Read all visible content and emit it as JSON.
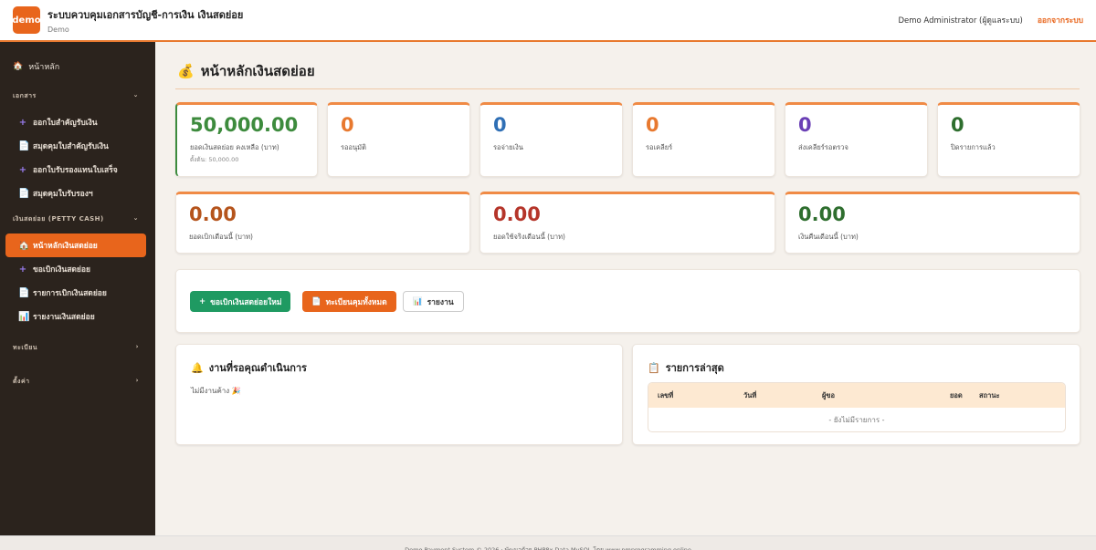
{
  "header": {
    "logo": "demo",
    "title": "ระบบควบคุมเอกสารบัญชี-การเงิน เงินสดย่อย",
    "subtitle": "Demo",
    "user": "Demo Administrator (ผู้ดูแลระบบ)",
    "logout": "ออกจากระบบ"
  },
  "sidebar": {
    "home": "หน้าหลัก",
    "sections": [
      {
        "label": "เอกสาร",
        "caret": "⌄"
      },
      {
        "label": "เงินสดย่อย (PETTY CASH)",
        "caret": "⌄"
      },
      {
        "label": "ทะเบียน",
        "caret": "›"
      },
      {
        "label": "ตั้งค่า",
        "caret": "›"
      }
    ],
    "doc_items": [
      {
        "label": "ออกใบสำคัญรับเงิน",
        "icon": "plus-icon"
      },
      {
        "label": "สมุดคุมใบสำคัญรับเงิน",
        "icon": "document-icon"
      },
      {
        "label": "ออกใบรับรองแทนใบเสร็จ",
        "icon": "plus-icon"
      },
      {
        "label": "สมุดคุมใบรับรองฯ",
        "icon": "document-icon"
      }
    ],
    "petty_items": [
      {
        "label": "หน้าหลักเงินสดย่อย",
        "icon": "home-icon"
      },
      {
        "label": "ขอเบิกเงินสดย่อย",
        "icon": "plus-icon"
      },
      {
        "label": "รายการเบิกเงินสดย่อย",
        "icon": "document-icon"
      },
      {
        "label": "รายงานเงินสดย่อย",
        "icon": "chart-icon"
      }
    ]
  },
  "main": {
    "title": "หน้าหลักเงินสดย่อย",
    "stats": [
      {
        "value": "50,000.00",
        "label": "ยอดเงินสดย่อย คงเหลือ (บาท)",
        "note": "ตั้งต้น: 50,000.00",
        "color": "#3d8b3d"
      },
      {
        "value": "0",
        "label": "รออนุมัติ",
        "color": "#e8792f"
      },
      {
        "value": "0",
        "label": "รอจ่ายเงิน",
        "color": "#2f6fb5"
      },
      {
        "value": "0",
        "label": "รอเคลียร์",
        "color": "#e8792f"
      },
      {
        "value": "0",
        "label": "ส่งเคลียร์รอตรวจ",
        "color": "#6a3fb5"
      },
      {
        "value": "0",
        "label": "ปิดรายการแล้ว",
        "color": "#2e6e2e"
      }
    ],
    "month_stats": [
      {
        "value": "0.00",
        "label": "ยอดเบิกเดือนนี้ (บาท)",
        "color": "#b5541c"
      },
      {
        "value": "0.00",
        "label": "ยอดใช้จริงเดือนนี้ (บาท)",
        "color": "#b5352a"
      },
      {
        "value": "0.00",
        "label": "เงินคืนเดือนนี้ (บาท)",
        "color": "#2e6e2e"
      }
    ],
    "buttons": {
      "new_request": "ขอเบิกเงินสดย่อยใหม่",
      "all_register": "ทะเบียนคุมทั้งหมด",
      "report": "รายงาน"
    },
    "pending": {
      "title": "งานที่รอคุณดำเนินการ",
      "empty": "ไม่มีงานค้าง 🎉"
    },
    "latest": {
      "title": "รายการล่าสุด",
      "columns": [
        "เลขที่",
        "วันที่",
        "ผู้ขอ",
        "ยอด",
        "สถานะ"
      ],
      "empty": "- ยังไม่มีรายการ -"
    }
  },
  "footer": "Demo Payment System © 2026 · พัฒนาด้วย PHP8x Data MySQL โดย www.pmprogramming.online"
}
